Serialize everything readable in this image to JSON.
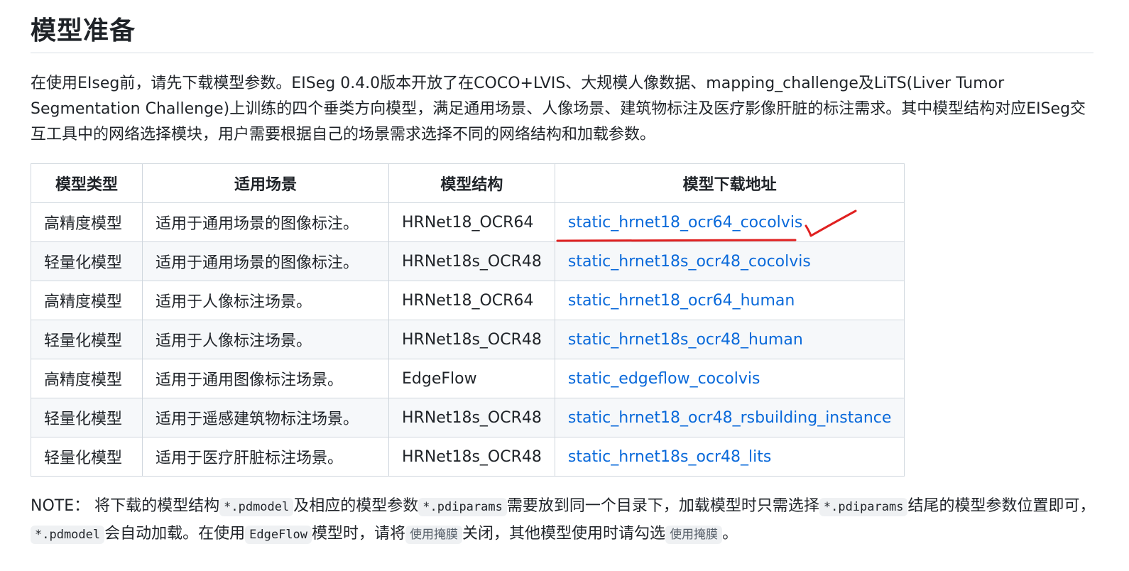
{
  "section_title": "模型准备",
  "intro_text": "在使用EIseg前，请先下载模型参数。EISeg 0.4.0版本开放了在COCO+LVIS、大规模人像数据、mapping_challenge及LiTS(Liver Tumor Segmentation Challenge)上训练的四个垂类方向模型，满足通用场景、人像场景、建筑物标注及医疗影像肝脏的标注需求。其中模型结构对应EISeg交互工具中的网络选择模块，用户需要根据自己的场景需求选择不同的网络结构和加载参数。",
  "table": {
    "headers": [
      "模型类型",
      "适用场景",
      "模型结构",
      "模型下载地址"
    ],
    "rows": [
      [
        "高精度模型",
        "适用于通用场景的图像标注。",
        "HRNet18_OCR64",
        "static_hrnet18_ocr64_cocolvis"
      ],
      [
        "轻量化模型",
        "适用于通用场景的图像标注。",
        "HRNet18s_OCR48",
        "static_hrnet18s_ocr48_cocolvis"
      ],
      [
        "高精度模型",
        "适用于人像标注场景。",
        "HRNet18_OCR64",
        "static_hrnet18_ocr64_human"
      ],
      [
        "轻量化模型",
        "适用于人像标注场景。",
        "HRNet18s_OCR48",
        "static_hrnet18s_ocr48_human"
      ],
      [
        "高精度模型",
        "适用于通用图像标注场景。",
        "EdgeFlow",
        "static_edgeflow_cocolvis"
      ],
      [
        "轻量化模型",
        "适用于遥感建筑物标注场景。",
        "HRNet18s_OCR48",
        "static_hrnet18_ocr48_rsbuilding_instance"
      ],
      [
        "轻量化模型",
        "适用于医疗肝脏标注场景。",
        "HRNet18s_OCR48",
        "static_hrnet18s_ocr48_lits"
      ]
    ]
  },
  "note": {
    "label": "NOTE：",
    "t1": " 将下载的模型结构",
    "c1": "*.pdmodel",
    "t2": "及相应的模型参数",
    "c2": "*.pdiparams",
    "t3": "需要放到同一个目录下，加载模型时只需选择",
    "c3": "*.pdiparams",
    "t4": "结尾的模型参数位置即可，",
    "c4": "*.pdmodel",
    "t5": "会自动加载。在使用",
    "c5": "EdgeFlow",
    "t6": "模型时，请将",
    "c6": "使用掩膜",
    "t7": "关闭，其他模型使用时请勾选",
    "c7": "使用掩膜",
    "t8": "。"
  },
  "colors": {
    "link": "#0969da",
    "annotation": "#e02020",
    "border": "#d0d7de",
    "stripe": "#f6f8fa"
  },
  "annotation": {
    "underline_row": 0,
    "checkmark": true
  }
}
